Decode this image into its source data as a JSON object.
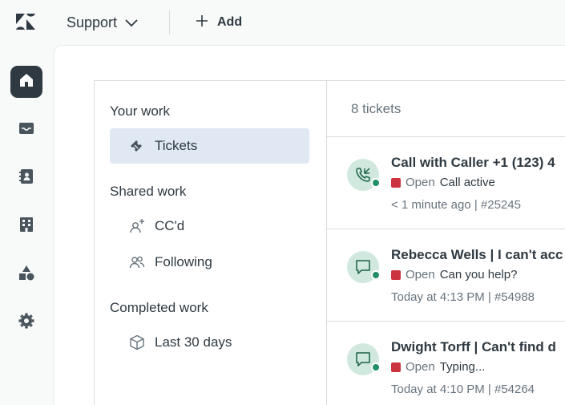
{
  "topbar": {
    "product_label": "Support",
    "add_label": "Add"
  },
  "icons": {
    "logo": "zendesk-logo",
    "rail": [
      "home-icon",
      "inbox-icon",
      "contacts-icon",
      "organizations-icon",
      "shapes-icon",
      "gear-icon"
    ]
  },
  "views": {
    "your_work_title": "Your work",
    "tickets_label": "Tickets",
    "shared_work_title": "Shared work",
    "ccd_label": "CC'd",
    "following_label": "Following",
    "completed_work_title": "Completed work",
    "last30_label": "Last 30 days"
  },
  "list": {
    "count_label": "8 tickets",
    "tickets": [
      {
        "channel": "phone-icon",
        "subject": "Call with Caller +1 (123) 4",
        "status": "Open",
        "description": "Call active",
        "meta": "< 1 minute ago | #25245"
      },
      {
        "channel": "chat-icon",
        "subject": "Rebecca Wells | I can't acc",
        "status": "Open",
        "description": "Can you help?",
        "meta": "Today at 4:13 PM | #54988"
      },
      {
        "channel": "chat-icon",
        "subject": "Dwight Torff | Can't find d",
        "status": "Open",
        "description": "Typing...",
        "meta": "Today at 4:10 PM | #54264"
      }
    ]
  },
  "colors": {
    "rail_active": "#2f3941",
    "selected_view": "#dfe8f3",
    "status_open": "#cc3340",
    "presence_online": "#228f67",
    "avatar_bg": "#d1e8df"
  }
}
